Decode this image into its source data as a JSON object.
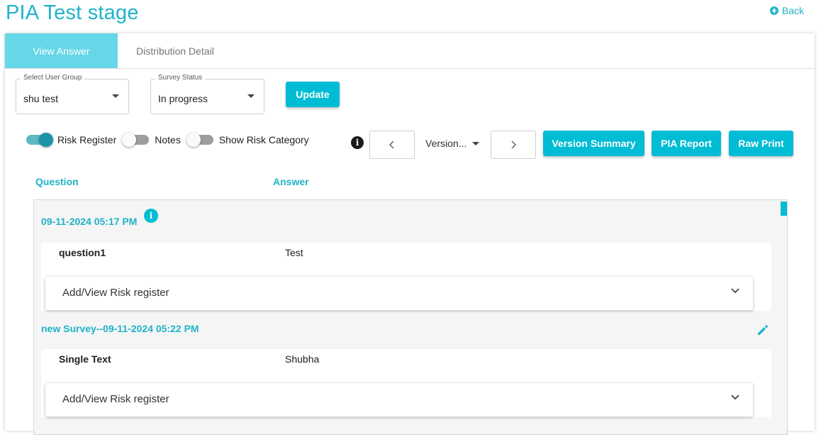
{
  "header": {
    "title": "PIA Test stage",
    "back_label": "Back"
  },
  "tabs": [
    {
      "label": "View Answer",
      "active": true
    },
    {
      "label": "Distribution Detail",
      "active": false
    }
  ],
  "filters": {
    "user_group": {
      "label": "Select User Group",
      "value": "shu test"
    },
    "survey_status": {
      "label": "Survey Status",
      "value": "In progress"
    },
    "update_label": "Update"
  },
  "toggles": [
    {
      "label": "Risk Register",
      "on": true
    },
    {
      "label": "Notes",
      "on": false
    },
    {
      "label": "Show Risk Category",
      "on": false
    }
  ],
  "toolbar": {
    "version_label": "Version...",
    "version_summary_label": "Version Summary",
    "pia_report_label": "PIA Report",
    "raw_print_label": "Raw Print"
  },
  "columns": {
    "question": "Question",
    "answer": "Answer"
  },
  "sections": [
    {
      "title": "09-11-2024 05:17 PM",
      "question": "question1",
      "answer": "Test",
      "accordion_label": "Add/View Risk register"
    },
    {
      "title": "new Survey--09-11-2024 05:22 PM",
      "question": "Single Text",
      "answer": "Shubha",
      "accordion_label": "Add/View Risk register"
    }
  ],
  "colors": {
    "accent": "#00bcd4",
    "accent_text": "#1fb3c9",
    "active_tab": "#66d7e7"
  },
  "icons": {
    "back": "arrow-left-circle-icon",
    "info": "info-icon",
    "edit": "pencil-icon",
    "prev": "chevron-left-icon",
    "next": "chevron-right-icon",
    "expand": "chevron-down-icon"
  }
}
